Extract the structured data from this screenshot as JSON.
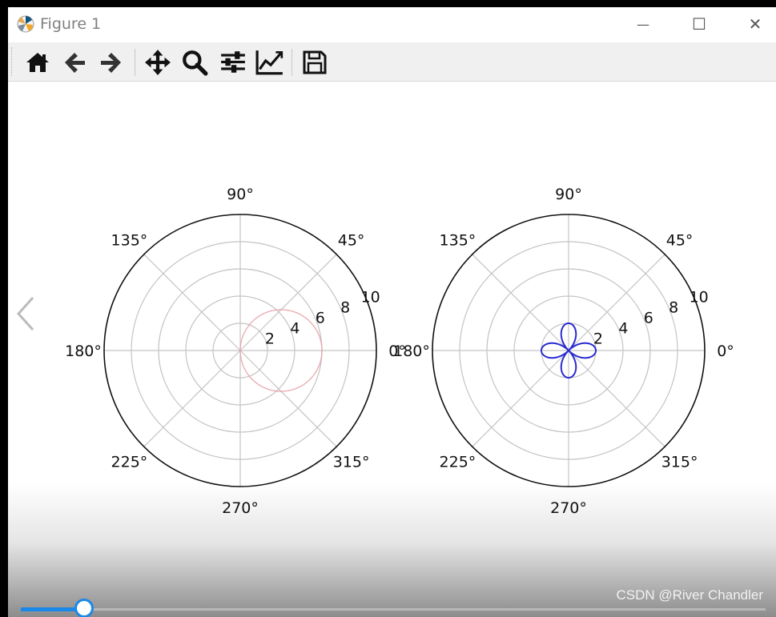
{
  "window": {
    "title": "Figure 1",
    "controls": {
      "minimize": "—",
      "maximize": "☐",
      "close": "✕"
    }
  },
  "toolbar": {
    "buttons": [
      {
        "id": "home",
        "icon": "home-icon"
      },
      {
        "id": "back",
        "icon": "arrow-left-icon"
      },
      {
        "id": "forward",
        "icon": "arrow-right-icon"
      },
      {
        "id": "pan",
        "icon": "move-icon"
      },
      {
        "id": "zoom",
        "icon": "magnifier-icon"
      },
      {
        "id": "subplots",
        "icon": "sliders-icon"
      },
      {
        "id": "edit-curves",
        "icon": "line-chart-icon"
      },
      {
        "id": "save",
        "icon": "floppy-disk-icon"
      }
    ]
  },
  "slider": {
    "value": 0.085
  },
  "watermark": "CSDN @River Chandler",
  "colors": {
    "accent": "#1a88e8",
    "series_left": "#e8a0a8",
    "series_right": "#2a2ad0"
  },
  "chart_data": [
    {
      "type": "polar-line",
      "angle_ticks": [
        "0°",
        "45°",
        "90°",
        "135°",
        "180°",
        "225°",
        "270°",
        "315°"
      ],
      "radial_ticks": [
        "2",
        "4",
        "6",
        "8",
        "10"
      ],
      "rlim": [
        0,
        10
      ],
      "grid": true,
      "series": [
        {
          "formula": "r = 6·cos(θ)",
          "style": "dotted",
          "color": "#e8a0a8",
          "rmax": 6
        }
      ]
    },
    {
      "type": "polar-line",
      "angle_ticks": [
        "0°",
        "45°",
        "90°",
        "135°",
        "180°",
        "225°",
        "270°",
        "315°"
      ],
      "radial_ticks": [
        "2",
        "4",
        "6",
        "8",
        "10"
      ],
      "rlim": [
        0,
        10
      ],
      "grid": true,
      "series": [
        {
          "formula": "r = 2·cos(2θ)",
          "style": "solid",
          "color": "#2a2ad0",
          "rmax": 2
        }
      ]
    }
  ]
}
